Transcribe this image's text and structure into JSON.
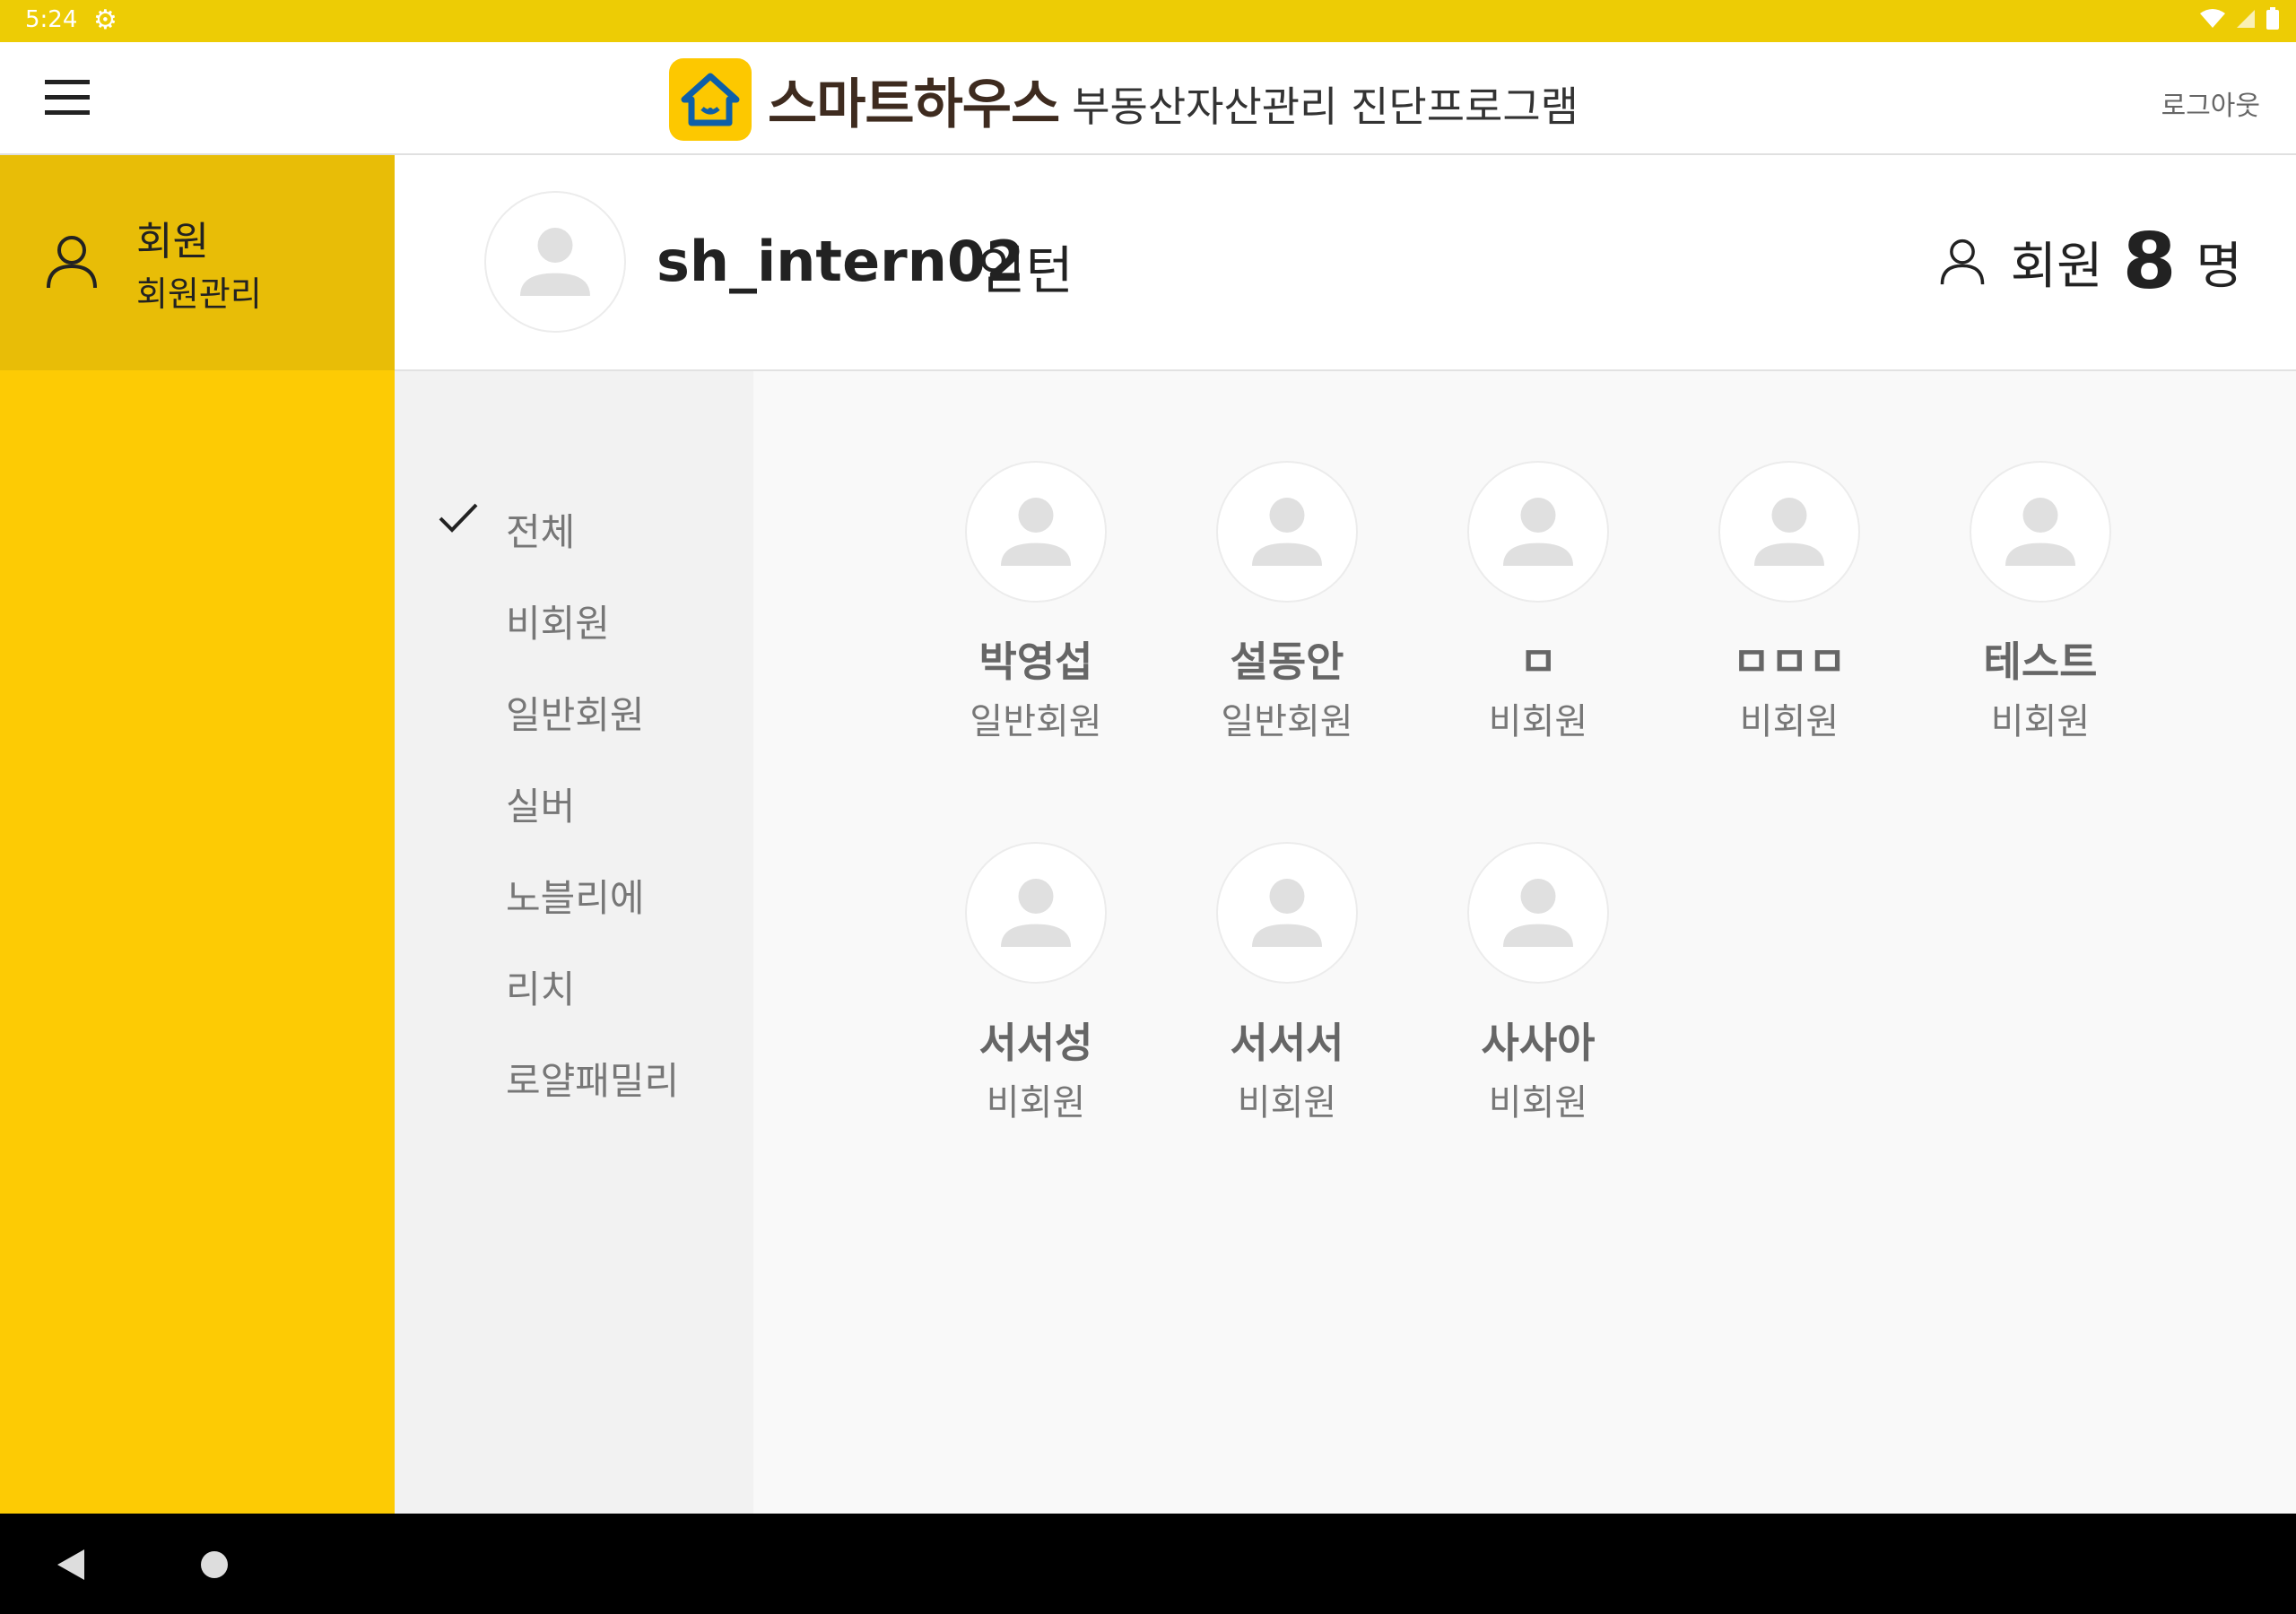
{
  "status_bar": {
    "time": "5:24"
  },
  "app_bar": {
    "brand_name": "스마트하우스",
    "brand_subtitle": "부동산자산관리 진단프로그램",
    "logout_label": "로그아웃"
  },
  "sidebar": {
    "items": [
      {
        "title": "회원",
        "subtitle": "회원관리",
        "icon": "person-icon"
      }
    ]
  },
  "profile": {
    "username": "sh_intern02",
    "role": "인턴",
    "member_count_label": "회원",
    "member_count": "8",
    "member_count_unit": "명"
  },
  "filters": {
    "selected": "전체",
    "items": [
      "전체",
      "비회원",
      "일반회원",
      "실버",
      "노블리에",
      "리치",
      "로얄패밀리"
    ]
  },
  "members": [
    {
      "name": "박영섭",
      "level": "일반회원"
    },
    {
      "name": "설동안",
      "level": "일반회원"
    },
    {
      "name": "ㅁ",
      "level": "비회원"
    },
    {
      "name": "ㅁㅁㅁ",
      "level": "비회원"
    },
    {
      "name": "테스트",
      "level": "비회원"
    },
    {
      "name": "서서성",
      "level": "비회원"
    },
    {
      "name": "서서서",
      "level": "비회원"
    },
    {
      "name": "사사아",
      "level": "비회원"
    }
  ],
  "colors": {
    "accent_yellow": "#fdcb04",
    "sidebar_active": "#e8bd07",
    "status_bar": "#edcc05",
    "brand_text": "#3e2b1f"
  }
}
